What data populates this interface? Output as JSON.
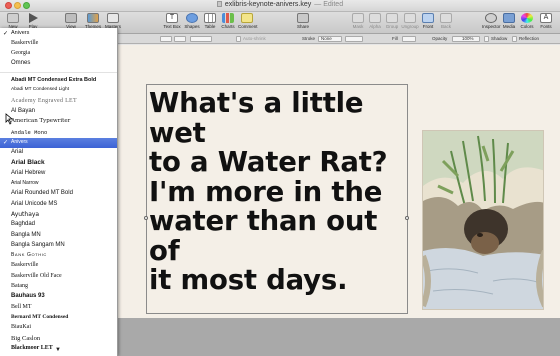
{
  "window": {
    "title": "exlibris-keynote-anivers.key",
    "status": "Edited"
  },
  "toolbar": {
    "items": [
      {
        "label": "New",
        "icon": "plus-icon"
      },
      {
        "label": "Play",
        "icon": "play-icon"
      },
      {
        "label": "View",
        "icon": "view-icon"
      },
      {
        "label": "Themes",
        "icon": "themes-icon"
      },
      {
        "label": "Masters",
        "icon": "masters-icon"
      },
      {
        "label": "Text Box",
        "icon": "textbox-icon"
      },
      {
        "label": "Shapes",
        "icon": "shapes-icon"
      },
      {
        "label": "Table",
        "icon": "table-icon"
      },
      {
        "label": "Charts",
        "icon": "charts-icon"
      },
      {
        "label": "Comment",
        "icon": "comment-icon"
      },
      {
        "label": "Share",
        "icon": "share-icon"
      },
      {
        "label": "Mask",
        "icon": "mask-icon"
      },
      {
        "label": "Alpha",
        "icon": "alpha-icon"
      },
      {
        "label": "Group",
        "icon": "group-icon"
      },
      {
        "label": "Ungroup",
        "icon": "ungroup-icon"
      },
      {
        "label": "Front",
        "icon": "front-icon"
      },
      {
        "label": "Back",
        "icon": "back-icon"
      },
      {
        "label": "Inspector",
        "icon": "inspector-icon"
      },
      {
        "label": "Media",
        "icon": "media-icon"
      },
      {
        "label": "Colors",
        "icon": "colors-icon"
      },
      {
        "label": "Fonts",
        "icon": "fonts-icon"
      }
    ]
  },
  "format_bar": {
    "auto_shrink": "Auto-shrink",
    "stroke_label": "Stroke",
    "stroke_value": "None",
    "fill_label": "Fill",
    "opacity_label": "Opacity",
    "opacity_value": "100%",
    "shadow_label": "Shadow",
    "reflection_label": "Reflection"
  },
  "font_menu": {
    "recent": [
      "Anivers",
      "Baskerville",
      "Georgia",
      "Omnes"
    ],
    "fonts": [
      "Abadi MT Condensed Extra Bold",
      "Abadi MT Condensed Light",
      "Academy Engraved LET",
      "Al Bayan",
      "American Typewriter",
      "Andale Mono",
      "Anivers",
      "Arial",
      "Arial Black",
      "Arial Hebrew",
      "Arial Narrow",
      "Arial Rounded MT Bold",
      "Arial Unicode MS",
      "Ayuthaya",
      "Baghdad",
      "Bangla MN",
      "Bangla Sangam MN",
      "Bank Gothic",
      "Baskerville",
      "Baskerville Old Face",
      "Batang",
      "Bauhaus 93",
      "Bell MT",
      "Bernard MT Condensed",
      "BiauKai",
      "Big Caslon",
      "Blackmoor LET"
    ],
    "selected": "Anivers",
    "current_check": "✓"
  },
  "slide": {
    "text": "What's a little wet\nto a Water Rat?\nI'm more in the\nwater than out of\nit most days."
  },
  "colors": {
    "selection": "#3c63d6",
    "slide_bg": "#f4efe7",
    "canvas_bg": "#a9a9a9"
  }
}
